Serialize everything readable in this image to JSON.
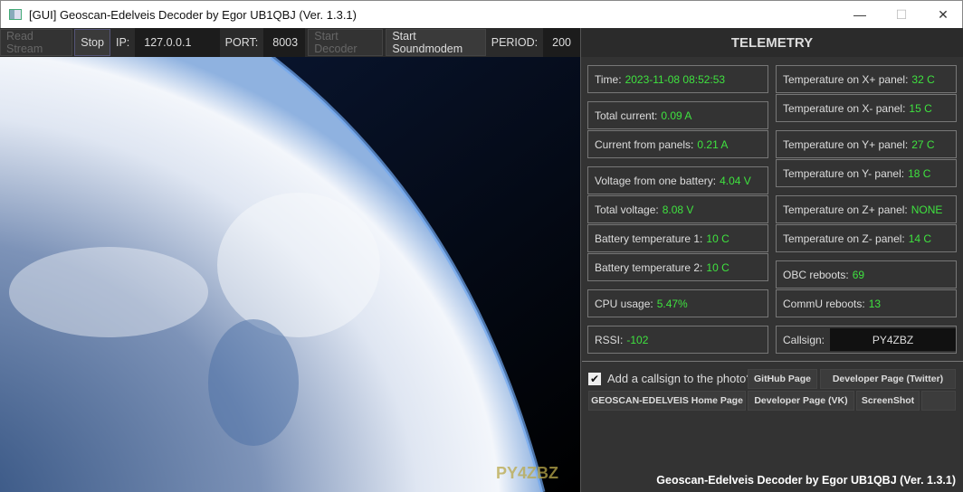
{
  "window": {
    "title": "[GUI] Geoscan-Edelveis Decoder by Egor UB1QBJ (Ver. 1.3.1)",
    "minimize": "—",
    "maximize": "☐",
    "close": "✕"
  },
  "toolbar": {
    "read_stream": "Read Stream",
    "stop": "Stop",
    "ip_label": "IP:",
    "ip_value": "127.0.0.1",
    "port_label": "PORT:",
    "port_value": "8003",
    "start_decoder": "Start Decoder",
    "start_soundmodem": "Start Soundmodem",
    "period_label": "PERIOD:",
    "period_value": "200"
  },
  "photo": {
    "watermark": "PY4ZBZ"
  },
  "telemetry": {
    "title": "TELEMETRY",
    "left": [
      {
        "label": "Time:",
        "value": "2023-11-08 08:52:53"
      },
      {
        "label": "Total current:",
        "value": "0.09 A"
      },
      {
        "label": "Current from panels:",
        "value": "0.21 A"
      },
      {
        "label": "Voltage from one battery:",
        "value": "4.04 V"
      },
      {
        "label": "Total voltage:",
        "value": "8.08 V"
      },
      {
        "label": "Battery temperature 1:",
        "value": "10 C"
      },
      {
        "label": "Battery temperature 2:",
        "value": "10 C"
      },
      {
        "label": "CPU usage:",
        "value": "5.47%"
      },
      {
        "label": "RSSI:",
        "value": "-102"
      }
    ],
    "right": [
      {
        "label": "Temperature on X+ panel:",
        "value": "32 C"
      },
      {
        "label": "Temperature on X- panel:",
        "value": "15 C"
      },
      {
        "label": "Temperature on Y+ panel:",
        "value": "27 C"
      },
      {
        "label": "Temperature on Y- panel:",
        "value": "18 C"
      },
      {
        "label": "Temperature on Z+ panel:",
        "value": " NONE"
      },
      {
        "label": "Temperature on Z- panel:",
        "value": "14 C"
      },
      {
        "label": "OBC reboots:",
        "value": "69"
      },
      {
        "label": "CommU reboots:",
        "value": "13"
      }
    ],
    "callsign_label": "Callsign:",
    "callsign_value": "PY4ZBZ"
  },
  "controls": {
    "add_callsign": "Add a callsign to the photo?",
    "github": "GitHub Page",
    "dev_twitter": "Developer Page (Twitter)",
    "home": "GEOSCAN-EDELVEIS Home Page",
    "dev_vk": "Developer Page (VK)",
    "screenshot": "ScreenShot"
  },
  "footer": "Geoscan-Edelveis Decoder by Egor UB1QBJ (Ver. 1.3.1)",
  "colors": {
    "value_green": "#3fe23f",
    "panel": "#333333"
  }
}
